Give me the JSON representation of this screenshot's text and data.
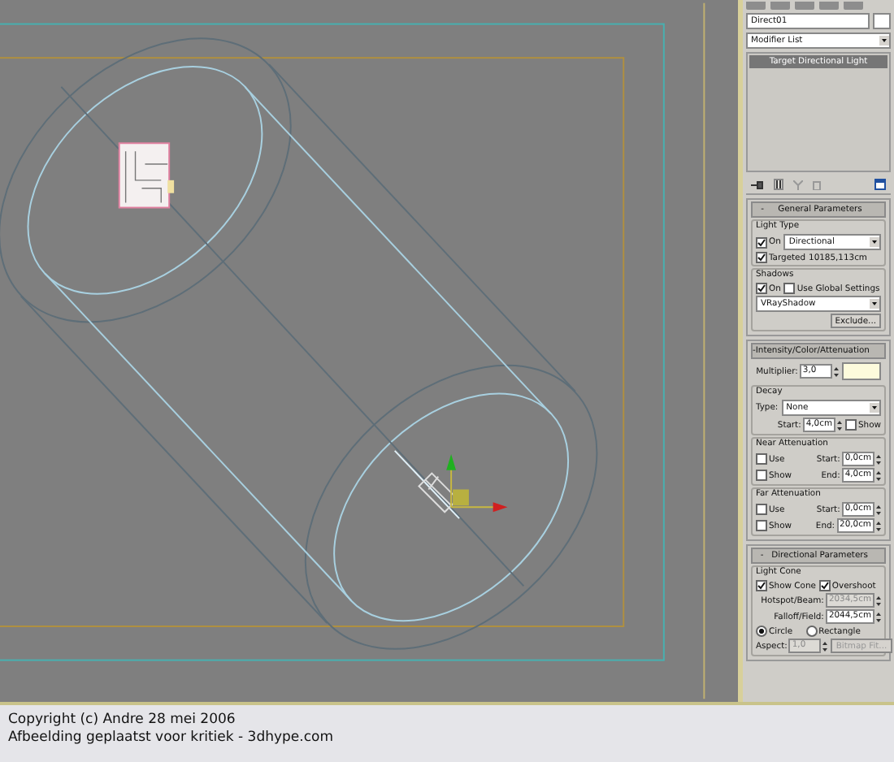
{
  "command_panel": {
    "object_name": "Direct01",
    "modifier_list": "Modifier List",
    "modifier_stack": [
      {
        "label": "Target Directional Light",
        "selected": true
      }
    ],
    "rollouts": [
      {
        "marker": "-",
        "title": "General Parameters",
        "groups": [
          {
            "title": "Light Type",
            "rows": [
              {
                "items": [
                  {
                    "kind": "checkbox",
                    "label": "On",
                    "checked": true
                  },
                  {
                    "kind": "dropdown",
                    "value": "Directional"
                  }
                ]
              },
              {
                "items": [
                  {
                    "kind": "checkbox",
                    "label": "Targeted",
                    "checked": true
                  },
                  {
                    "kind": "label",
                    "text": "10185,113cm"
                  }
                ]
              }
            ]
          },
          {
            "title": "Shadows",
            "rows": [
              {
                "items": [
                  {
                    "kind": "checkbox",
                    "label": "On",
                    "checked": true
                  },
                  {
                    "kind": "checkbox",
                    "label": "Use Global Settings",
                    "checked": false
                  }
                ]
              },
              {
                "items": [
                  {
                    "kind": "dropdown",
                    "value": "VRayShadow"
                  }
                ]
              },
              {
                "items": [
                  {
                    "kind": "button",
                    "label": "Exclude...",
                    "disabled": false
                  }
                ]
              }
            ]
          }
        ]
      },
      {
        "marker": "-",
        "title": "Intensity/Color/Attenuation",
        "groups": [
          {
            "rows": [
              {
                "items": [
                  {
                    "kind": "spinner",
                    "label": "Multiplier:",
                    "value": "3,0",
                    "disabled": false
                  },
                  {
                    "kind": "swatch",
                    "color": "#fdfbdc"
                  }
                ]
              }
            ]
          },
          {
            "title": "Decay",
            "rows": [
              {
                "items": [
                  {
                    "kind": "label",
                    "text": "Type:"
                  },
                  {
                    "kind": "dropdown",
                    "value": "None"
                  }
                ]
              },
              {
                "items": [
                  {
                    "kind": "spinner",
                    "label": "Start:",
                    "value": "4,0cm",
                    "disabled": false
                  },
                  {
                    "kind": "checkbox",
                    "label": "Show",
                    "checked": false
                  }
                ]
              }
            ]
          },
          {
            "title": "Near Attenuation",
            "rows": [
              {
                "items": [
                  {
                    "kind": "checkbox",
                    "label": "Use",
                    "checked": false
                  },
                  {
                    "kind": "spinner",
                    "label": "Start:",
                    "value": "0,0cm",
                    "disabled": false
                  }
                ]
              },
              {
                "items": [
                  {
                    "kind": "checkbox",
                    "label": "Show",
                    "checked": false
                  },
                  {
                    "kind": "spinner",
                    "label": "End:",
                    "value": "4,0cm",
                    "disabled": false
                  }
                ]
              }
            ]
          },
          {
            "title": "Far Attenuation",
            "rows": [
              {
                "items": [
                  {
                    "kind": "checkbox",
                    "label": "Use",
                    "checked": false
                  },
                  {
                    "kind": "spinner",
                    "label": "Start:",
                    "value": "0,0cm",
                    "disabled": false
                  }
                ]
              },
              {
                "items": [
                  {
                    "kind": "checkbox",
                    "label": "Show",
                    "checked": false
                  },
                  {
                    "kind": "spinner",
                    "label": "End:",
                    "value": "20,0cm",
                    "disabled": false
                  }
                ]
              }
            ]
          }
        ]
      },
      {
        "marker": "-",
        "title": "Directional Parameters",
        "groups": [
          {
            "title": "Light Cone",
            "rows": [
              {
                "items": [
                  {
                    "kind": "checkbox",
                    "label": "Show Cone",
                    "checked": true
                  },
                  {
                    "kind": "checkbox",
                    "label": "Overshoot",
                    "checked": true
                  }
                ]
              },
              {
                "items": [
                  {
                    "kind": "spinner",
                    "label": "Hotspot/Beam:",
                    "value": "2034,5cm",
                    "disabled": true
                  }
                ]
              },
              {
                "items": [
                  {
                    "kind": "spinner",
                    "label": "Falloff/Field:",
                    "value": "2044,5cm",
                    "disabled": false
                  }
                ]
              },
              {
                "items": [
                  {
                    "kind": "radio",
                    "label": "Circle",
                    "selected": true
                  },
                  {
                    "kind": "radio",
                    "label": "Rectangle",
                    "selected": false
                  }
                ]
              },
              {
                "items": [
                  {
                    "kind": "spinner",
                    "label": "Aspect:",
                    "value": "1,0",
                    "disabled": true
                  },
                  {
                    "kind": "button",
                    "label": "Bitmap Fit...",
                    "disabled": true
                  }
                ]
              }
            ]
          }
        ]
      }
    ]
  },
  "caption": [
    "Copyright (c) Andre 28 mei 2006",
    "Afbeelding geplaatst voor kritiek - 3dhype.com"
  ]
}
